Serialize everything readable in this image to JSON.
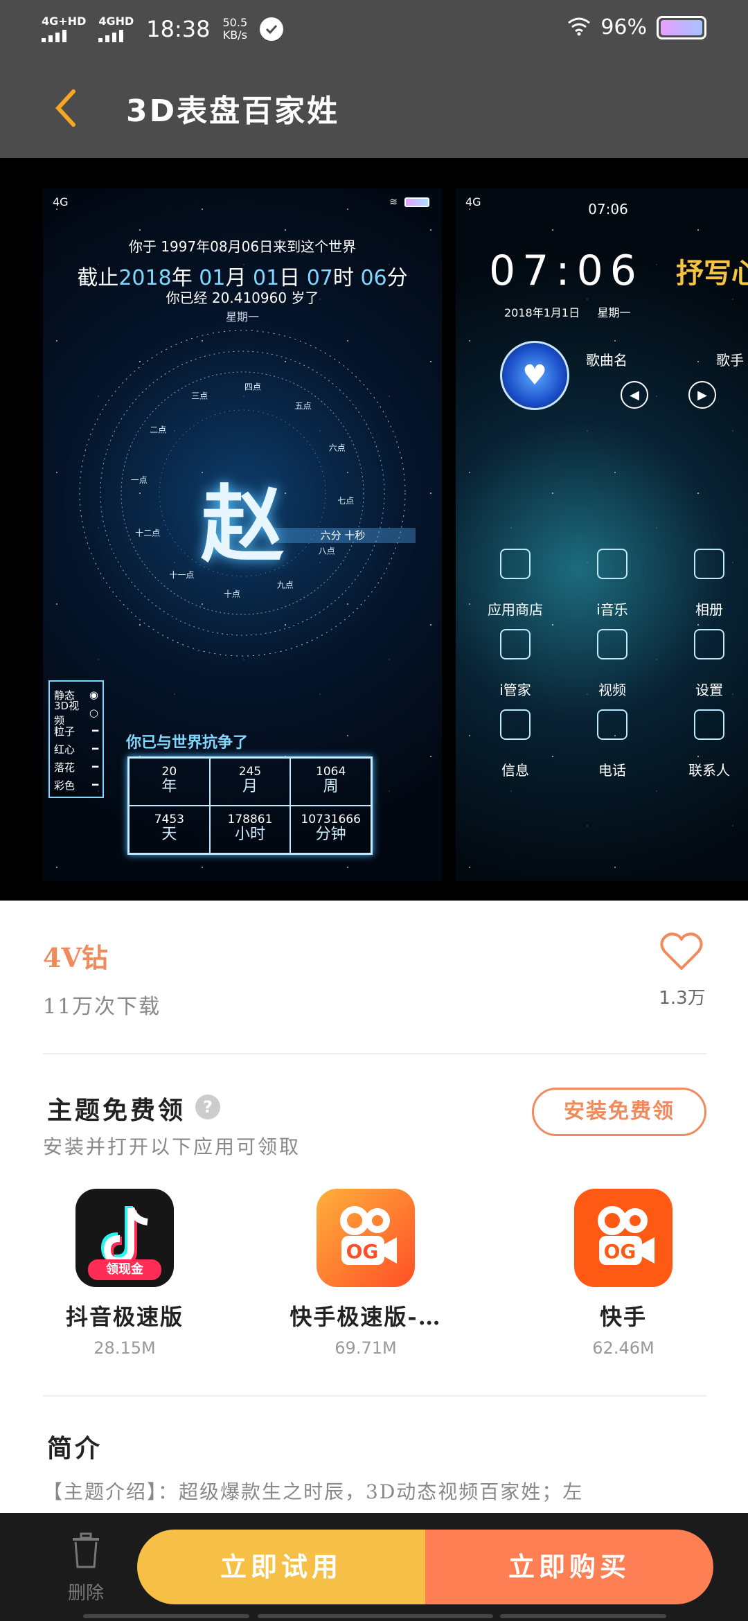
{
  "status_bar": {
    "net1": "4G+HD",
    "net2": "4GHD",
    "time": "18:38",
    "speed_value": "50.5",
    "speed_unit": "KB/s",
    "battery_pct": "96%"
  },
  "header": {
    "title": "3D表盘百家姓"
  },
  "preview1": {
    "network": "4G",
    "line1": "你于 1997年08月06日来到这个世界",
    "line2_prefix": "截止",
    "line2_year": "2018",
    "line2_y": "年",
    "line2_month": "01",
    "line2_m": "月",
    "line2_day": "01",
    "line2_d": "日",
    "line2_hour": "07",
    "line2_h": "时",
    "line2_min": "06",
    "line2_mi": "分",
    "line3": "你已经 20.410960 岁了",
    "weekday": "星期一",
    "surname": "赵",
    "wheel_labels": [
      "四点",
      "五点",
      "六点",
      "七点",
      "八点",
      "九点",
      "十点",
      "十一点",
      "十二点",
      "一点",
      "二点",
      "三点"
    ],
    "highlight_label": "六分 十秒",
    "modes": [
      "静态",
      "3D视频",
      "粒子",
      "红心",
      "落花",
      "彩色"
    ],
    "stats_title": "你已与世界抗争了",
    "stats": [
      {
        "value": "20",
        "unit": "年"
      },
      {
        "value": "245",
        "unit": "月"
      },
      {
        "value": "1064",
        "unit": "周"
      },
      {
        "value": "7453",
        "unit": "天"
      },
      {
        "value": "178861",
        "unit": "小时"
      },
      {
        "value": "10731666",
        "unit": "分钟"
      }
    ]
  },
  "preview2": {
    "network": "4G",
    "status_time": "07:06",
    "clock": "07:06",
    "tag": "抒写心",
    "date": "2018年1月1日",
    "weekday": "星期一",
    "song": "歌曲名",
    "singer": "歌手",
    "apps": [
      {
        "label": "应用商店",
        "icon": "store-icon"
      },
      {
        "label": "i音乐",
        "icon": "music-icon"
      },
      {
        "label": "相册",
        "icon": "album-icon"
      },
      {
        "label": "i管家",
        "icon": "shield-icon"
      },
      {
        "label": "视频",
        "icon": "video-icon"
      },
      {
        "label": "设置",
        "icon": "gear-icon"
      },
      {
        "label": "信息",
        "icon": "message-icon"
      },
      {
        "label": "电话",
        "icon": "phone-icon"
      },
      {
        "label": "联系人",
        "icon": "contact-icon"
      }
    ]
  },
  "info": {
    "price": "4V钻",
    "downloads": "11万次下载",
    "favorites": "1.3万"
  },
  "free_section": {
    "title": "主题免费领",
    "help": "?",
    "subtitle": "安装并打开以下应用可领取",
    "install_label": "安装免费领",
    "apps": [
      {
        "name": "抖音极速版",
        "size": "28.15M",
        "badge": "领现金"
      },
      {
        "name": "快手极速版-…",
        "size": "69.71M"
      },
      {
        "name": "快手",
        "size": "62.46M"
      }
    ]
  },
  "intro": {
    "title": "简介",
    "text": "【主题介绍】：超级爆款生之时辰，3D动态视频百家姓；左"
  },
  "bottom": {
    "delete_label": "删除",
    "try_label": "立即试用",
    "buy_label": "立即购买"
  },
  "colors": {
    "accent_orange": "#f08a5d",
    "try_yellow": "#f6c046",
    "buy_orange": "#ff7f54",
    "header_gray": "#4c4c4c"
  }
}
